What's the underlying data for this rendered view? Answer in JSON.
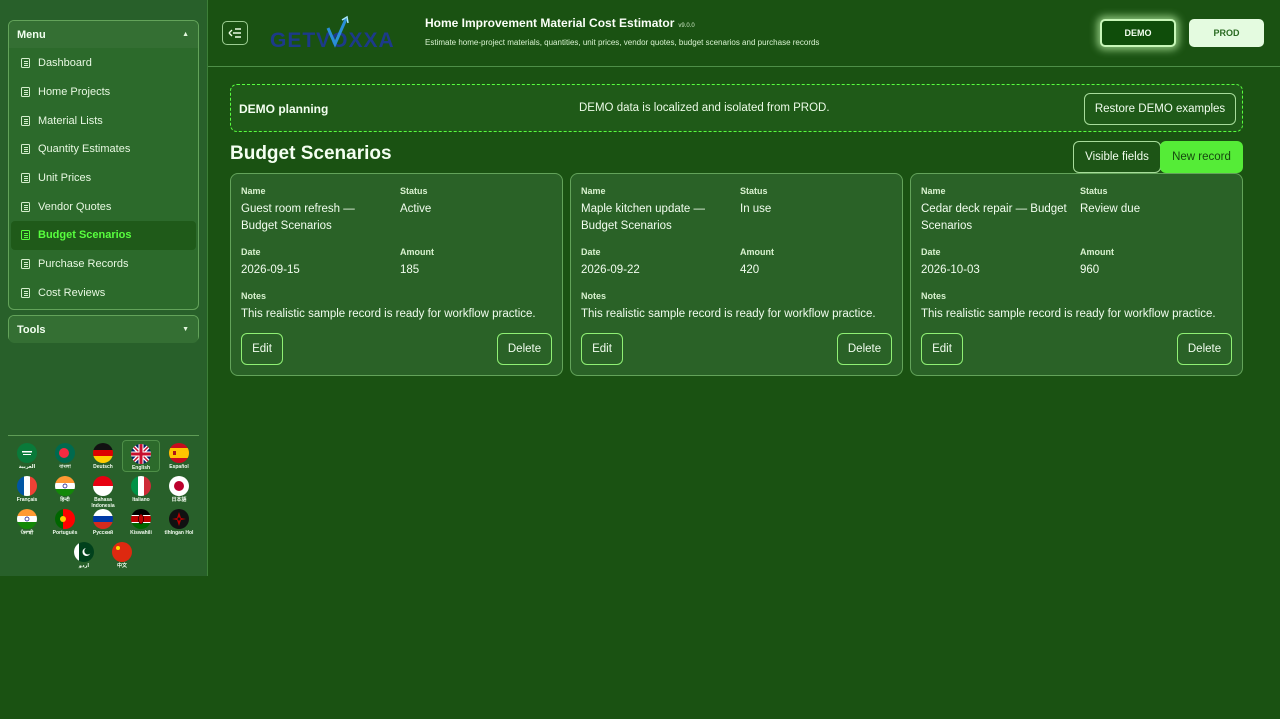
{
  "sidebar": {
    "menu_title": "Menu",
    "tools_title": "Tools",
    "items": [
      {
        "label": "Dashboard"
      },
      {
        "label": "Home Projects"
      },
      {
        "label": "Material Lists"
      },
      {
        "label": "Quantity Estimates"
      },
      {
        "label": "Unit Prices"
      },
      {
        "label": "Vendor Quotes"
      },
      {
        "label": "Budget Scenarios",
        "active": true
      },
      {
        "label": "Purchase Records"
      },
      {
        "label": "Cost Reviews"
      }
    ],
    "languages": [
      {
        "name": "العربية",
        "flag": "saudi-arabia-flag-icon"
      },
      {
        "name": "বাংলা",
        "flag": "bangladesh-flag-icon"
      },
      {
        "name": "Deutsch",
        "flag": "germany-flag-icon"
      },
      {
        "name": "English",
        "flag": "uk-flag-icon",
        "current": true
      },
      {
        "name": "Español",
        "flag": "spain-flag-icon"
      },
      {
        "name": "Français",
        "flag": "france-flag-icon"
      },
      {
        "name": "हिन्दी",
        "flag": "india-flag-icon"
      },
      {
        "name": "Bahasa Indonesia",
        "flag": "indonesia-flag-icon"
      },
      {
        "name": "Italiano",
        "flag": "italy-flag-icon"
      },
      {
        "name": "日本語",
        "flag": "japan-flag-icon"
      },
      {
        "name": "ਪੰਜਾਬੀ",
        "flag": "india-flag-icon"
      },
      {
        "name": "Português",
        "flag": "portugal-flag-icon"
      },
      {
        "name": "Русский",
        "flag": "russia-flag-icon"
      },
      {
        "name": "Kiswahili",
        "flag": "kenya-flag-icon"
      },
      {
        "name": "tlhIngan Hol",
        "flag": "klingon-emblem-icon"
      },
      {
        "name": "اردو",
        "flag": "pakistan-flag-icon"
      },
      {
        "name": "中文",
        "flag": "china-flag-icon"
      }
    ]
  },
  "header": {
    "logo_text": "GETVOXXA",
    "title": "Home Improvement Material Cost Estimator",
    "version": "v9.0.0",
    "subtitle": "Estimate home-project materials, quantities, unit prices, vendor quotes, budget scenarios and purchase records",
    "demo_label": "DEMO",
    "prod_label": "PROD"
  },
  "banner": {
    "label": "DEMO planning",
    "message": "DEMO data is localized and isolated from PROD.",
    "restore_label": "Restore DEMO examples"
  },
  "section": {
    "title": "Budget Scenarios",
    "visible_fields_label": "Visible fields",
    "new_record_label": "New record"
  },
  "field_labels": {
    "name": "Name",
    "status": "Status",
    "date": "Date",
    "amount": "Amount",
    "notes": "Notes",
    "edit": "Edit",
    "delete": "Delete"
  },
  "records": [
    {
      "name": "Guest room refresh — Budget Scenarios",
      "status": "Active",
      "date": "2026-09-15",
      "amount": "185",
      "notes": "This realistic sample record is ready for workflow practice."
    },
    {
      "name": "Maple kitchen update — Budget Scenarios",
      "status": "In use",
      "date": "2026-09-22",
      "amount": "420",
      "notes": "This realistic sample record is ready for workflow practice."
    },
    {
      "name": "Cedar deck repair — Budget Scenarios",
      "status": "Review due",
      "date": "2026-10-03",
      "amount": "960",
      "notes": "This realistic sample record is ready for workflow practice."
    }
  ],
  "colors": {
    "background": "#1a5212",
    "accent": "#55ec37",
    "active_text": "#58ff3e",
    "card": "#2a6227"
  }
}
